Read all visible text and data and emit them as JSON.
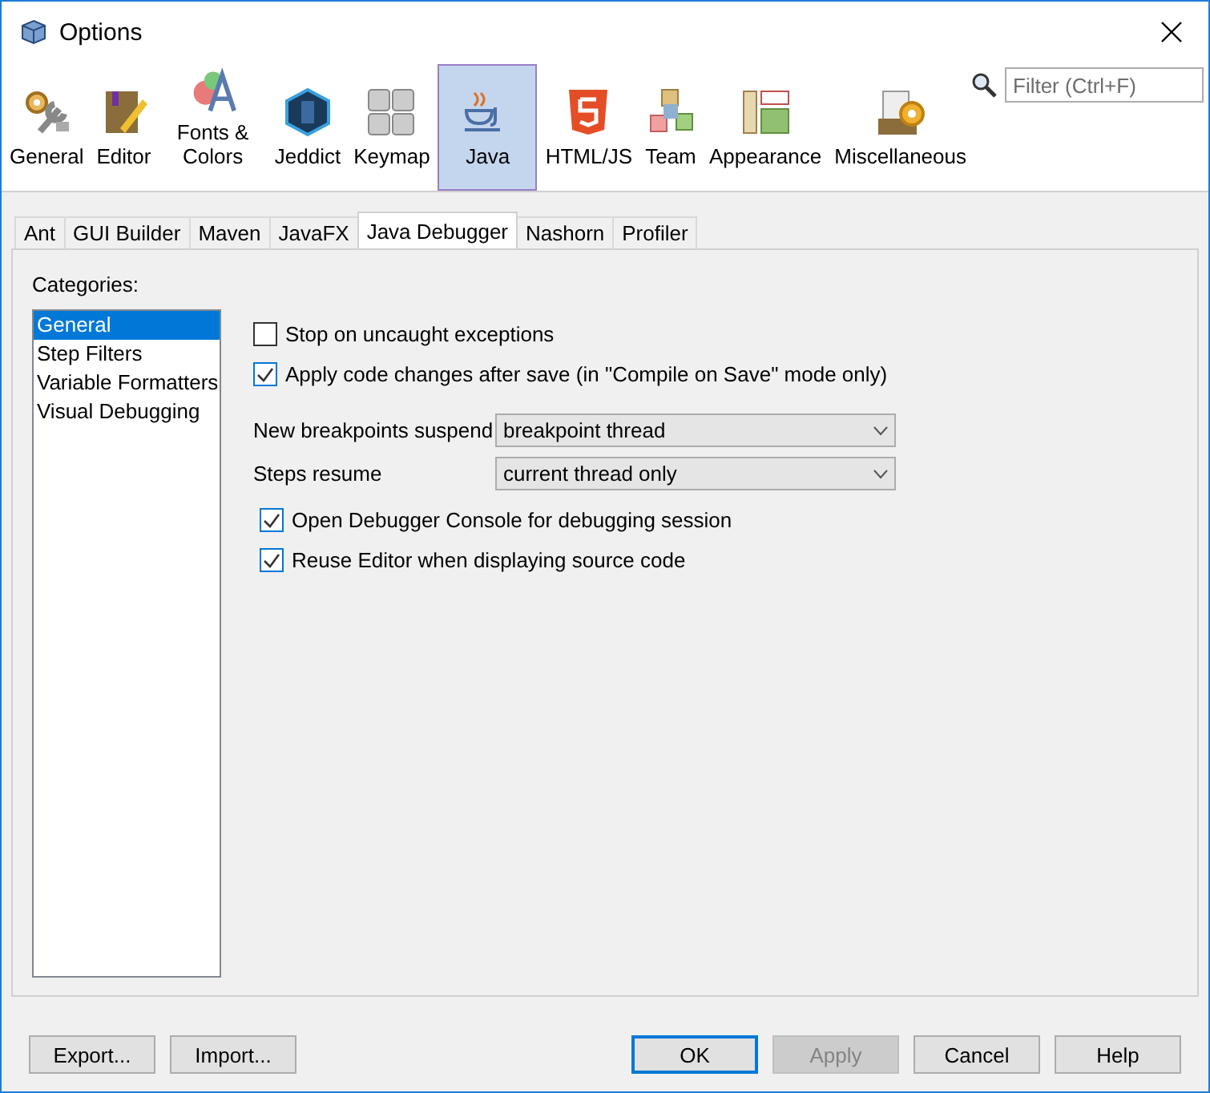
{
  "window": {
    "title": "Options"
  },
  "toolbar": [
    {
      "label": "General",
      "kind": "general",
      "selected": false
    },
    {
      "label": "Editor",
      "kind": "editor",
      "selected": false
    },
    {
      "label": "Fonts & Colors",
      "kind": "fonts",
      "selected": false
    },
    {
      "label": "Jeddict",
      "kind": "jeddict",
      "selected": false
    },
    {
      "label": "Keymap",
      "kind": "keymap",
      "selected": false
    },
    {
      "label": "Java",
      "kind": "java",
      "selected": true
    },
    {
      "label": "HTML/JS",
      "kind": "html",
      "selected": false
    },
    {
      "label": "Team",
      "kind": "team",
      "selected": false
    },
    {
      "label": "Appearance",
      "kind": "appearance",
      "selected": false
    },
    {
      "label": "Miscellaneous",
      "kind": "misc",
      "selected": false
    }
  ],
  "filter": {
    "placeholder": "Filter (Ctrl+F)"
  },
  "tabs": [
    {
      "label": "Ant",
      "selected": false
    },
    {
      "label": "GUI Builder",
      "selected": false
    },
    {
      "label": "Maven",
      "selected": false
    },
    {
      "label": "JavaFX",
      "selected": false
    },
    {
      "label": "Java Debugger",
      "selected": true
    },
    {
      "label": "Nashorn",
      "selected": false
    },
    {
      "label": "Profiler",
      "selected": false
    }
  ],
  "categories": {
    "label": "Categories:",
    "items": [
      {
        "label": "General",
        "selected": true
      },
      {
        "label": "Step Filters",
        "selected": false
      },
      {
        "label": "Variable Formatters",
        "selected": false
      },
      {
        "label": "Visual Debugging",
        "selected": false
      }
    ]
  },
  "options_top": [
    {
      "label": "Stop on uncaught exceptions",
      "checked": false
    },
    {
      "label": "Apply code changes after save (in \"Compile on Save\" mode only)",
      "checked": true
    }
  ],
  "dropdowns": [
    {
      "label": "New breakpoints suspend",
      "value": "breakpoint thread"
    },
    {
      "label": "Steps resume",
      "value": "current thread only"
    }
  ],
  "options_bottom": [
    {
      "label": "Open Debugger Console for debugging session",
      "checked": true
    },
    {
      "label": "Reuse Editor when displaying source code",
      "checked": true
    }
  ],
  "buttons_left": [
    {
      "label": "Export...",
      "default": false,
      "disabled": false
    },
    {
      "label": "Import...",
      "default": false,
      "disabled": false
    }
  ],
  "buttons_right": [
    {
      "label": "OK",
      "default": true,
      "disabled": false
    },
    {
      "label": "Apply",
      "default": false,
      "disabled": true
    },
    {
      "label": "Cancel",
      "default": false,
      "disabled": false
    },
    {
      "label": "Help",
      "default": false,
      "disabled": false
    }
  ]
}
